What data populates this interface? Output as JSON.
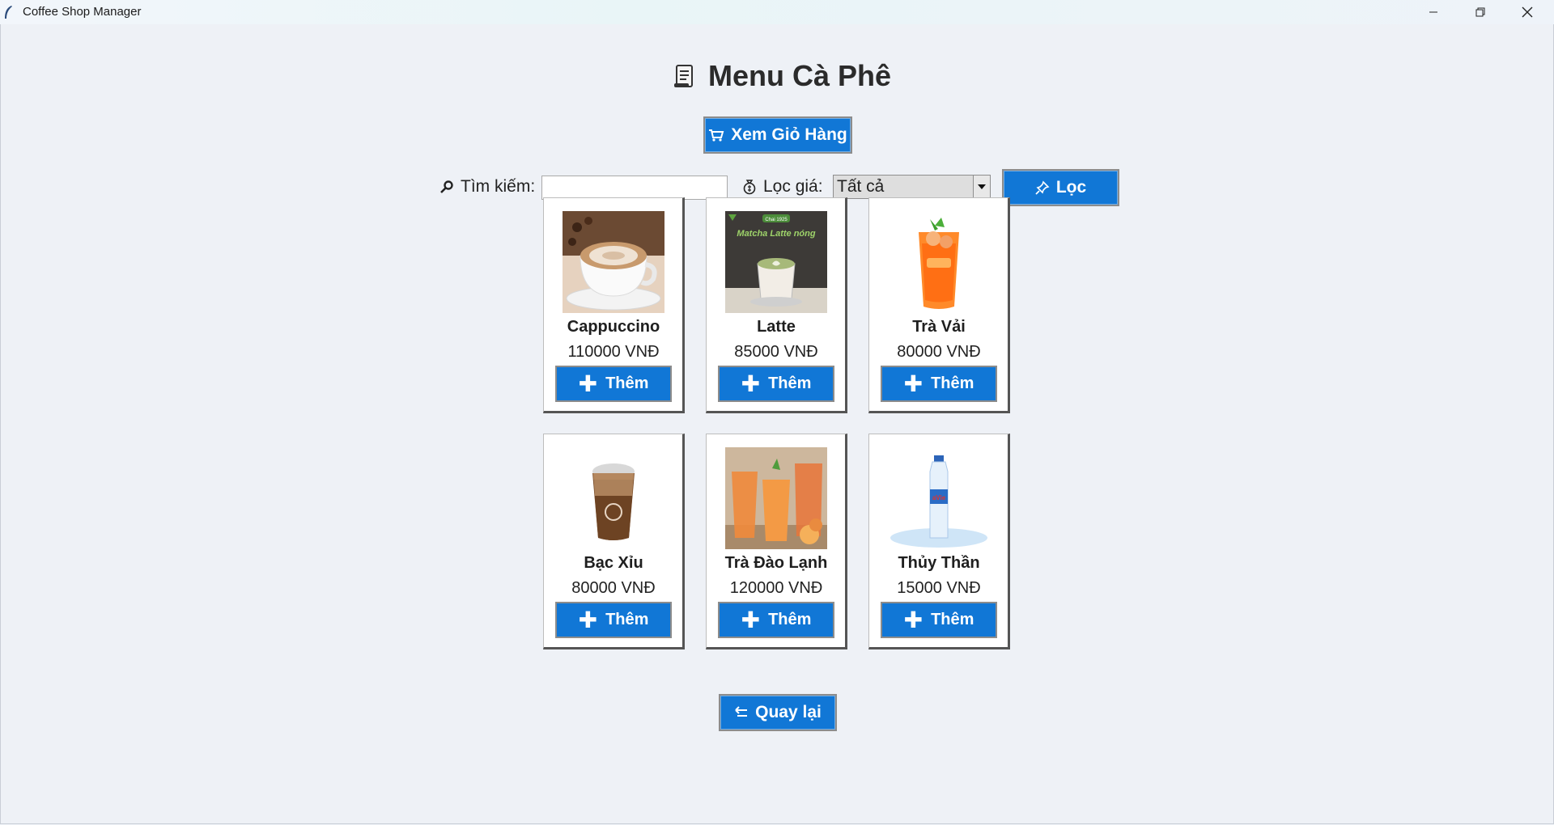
{
  "window": {
    "title": "Coffee Shop Manager"
  },
  "header": {
    "title": "Menu Cà Phê"
  },
  "toolbar": {
    "cart_label": "Xem Giỏ Hàng",
    "search_label": "Tìm kiếm:",
    "search_value": "",
    "price_filter_label": "Lọc giá:",
    "price_filter_selected": "Tất cả",
    "filter_button_label": "Lọc"
  },
  "products": [
    {
      "name": "Cappuccino",
      "price": "110000 VNĐ",
      "add_label": "Thêm",
      "icon": "cappuccino-image"
    },
    {
      "name": "Latte",
      "price": "85000 VNĐ",
      "add_label": "Thêm",
      "icon": "latte-image"
    },
    {
      "name": "Trà Vải",
      "price": "80000 VNĐ",
      "add_label": "Thêm",
      "icon": "lychee-tea-image"
    },
    {
      "name": "Bạc Xỉu",
      "price": "80000 VNĐ",
      "add_label": "Thêm",
      "icon": "bac-xiu-image"
    },
    {
      "name": "Trà Đào Lạnh",
      "price": "120000 VNĐ",
      "add_label": "Thêm",
      "icon": "peach-tea-image"
    },
    {
      "name": "Thủy Thần",
      "price": "15000 VNĐ",
      "add_label": "Thêm",
      "icon": "water-bottle-image"
    }
  ],
  "footer": {
    "back_label": "Quay lại"
  },
  "colors": {
    "accent": "#1177d6",
    "background": "#eef1f6"
  },
  "latte_image_text": {
    "badge": "Chai 1925",
    "caption": "Matcha Latte nóng"
  },
  "water_image_text": {
    "brand": "aVie"
  }
}
